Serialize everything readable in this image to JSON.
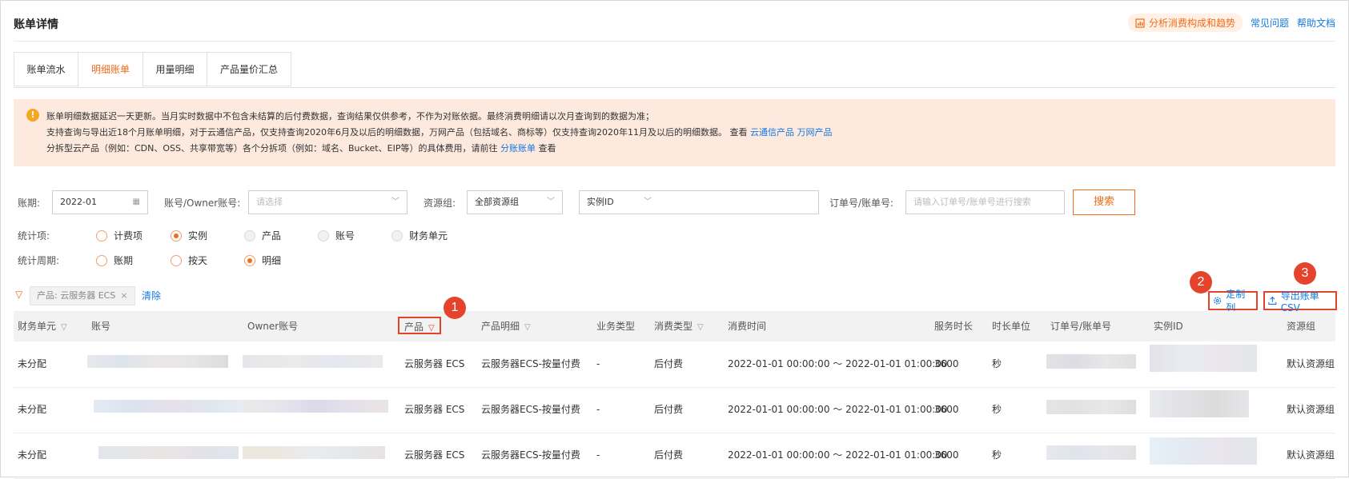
{
  "header": {
    "title": "账单详情",
    "trend_label": "分析消费构成和趋势",
    "faq_label": "常见问题",
    "help_label": "帮助文档"
  },
  "tabs": [
    {
      "label": "账单流水"
    },
    {
      "label": "明细账单"
    },
    {
      "label": "用量明细"
    },
    {
      "label": "产品量价汇总"
    }
  ],
  "notice": {
    "line1": "账单明细数据延迟一天更新。当月实时数据中不包含未结算的后付费数据，查询结果仅供参考，不作为对账依据。最终消费明细请以次月查询到的数据为准；",
    "line2": "支持查询与导出近18个月账单明细，对于云通信产品，仅支持查询2020年6月及以后的明细数据，万网产品（包括域名、商标等）仅支持查询2020年11月及以后的明细数据。 查看",
    "link_cloud_comm": "云通信产品",
    "link_wanwang": "万网产品",
    "line3": "分拆型云产品（例如：CDN、OSS、共享带宽等）各个分拆项（例如：域名、Bucket、EIP等）的具体费用，请前往",
    "link_split": "分账账单",
    "line3_tail": "查看"
  },
  "filters": {
    "period_label": "账期:",
    "period_value": "2022-01",
    "account_label": "账号/Owner账号:",
    "account_placeholder": "请选择",
    "resource_group_label": "资源组:",
    "resource_group_value": "全部资源组",
    "instance_type_value": "实例ID",
    "order_label": "订单号/账单号:",
    "order_placeholder": "请输入订单号/账单号进行搜索",
    "search_label": "搜索",
    "stat_item_label": "统计项:",
    "stat_items": [
      "计费项",
      "实例",
      "产品",
      "账号",
      "财务单元"
    ],
    "stat_period_label": "统计周期:",
    "stat_periods": [
      "账期",
      "按天",
      "明细"
    ]
  },
  "active_filter": {
    "chip_label": "产品: 云服务器 ECS",
    "chip_close": "×",
    "clear_label": "清除"
  },
  "actions": {
    "customize_columns": "定制列",
    "export_csv": "导出账单CSV"
  },
  "badges": [
    "1",
    "2",
    "3"
  ],
  "table": {
    "columns": [
      "财务单元",
      "账号",
      "Owner账号",
      "产品",
      "产品明细",
      "业务类型",
      "消费类型",
      "消费时间",
      "服务时长",
      "时长单位",
      "订单号/账单号",
      "实例ID",
      "资源组"
    ],
    "rows": [
      {
        "finance_unit": "未分配",
        "product": "云服务器 ECS",
        "product_detail": "云服务器ECS-按量付费",
        "biz_type": "-",
        "consume_type": "后付费",
        "consume_time": "2022-01-01 00:00:00 ～ 2022-01-01 01:00:00",
        "duration": "3600",
        "unit": "秒",
        "resource_group": "默认资源组"
      },
      {
        "finance_unit": "未分配",
        "product": "云服务器 ECS",
        "product_detail": "云服务器ECS-按量付费",
        "biz_type": "-",
        "consume_type": "后付费",
        "consume_time": "2022-01-01 00:00:00 ～ 2022-01-01 01:00:00",
        "duration": "3600",
        "unit": "秒",
        "resource_group": "默认资源组"
      },
      {
        "finance_unit": "未分配",
        "product": "云服务器 ECS",
        "product_detail": "云服务器ECS-按量付费",
        "biz_type": "-",
        "consume_type": "后付费",
        "consume_time": "2022-01-01 00:00:00 ～ 2022-01-01 01:00:00",
        "duration": "3600",
        "unit": "秒",
        "resource_group": "默认资源组"
      }
    ]
  },
  "colors": {
    "accent": "#f26b1d",
    "link": "#1478e0",
    "notice_bg": "#fde9dd",
    "annotation_red": "#e5432c"
  }
}
